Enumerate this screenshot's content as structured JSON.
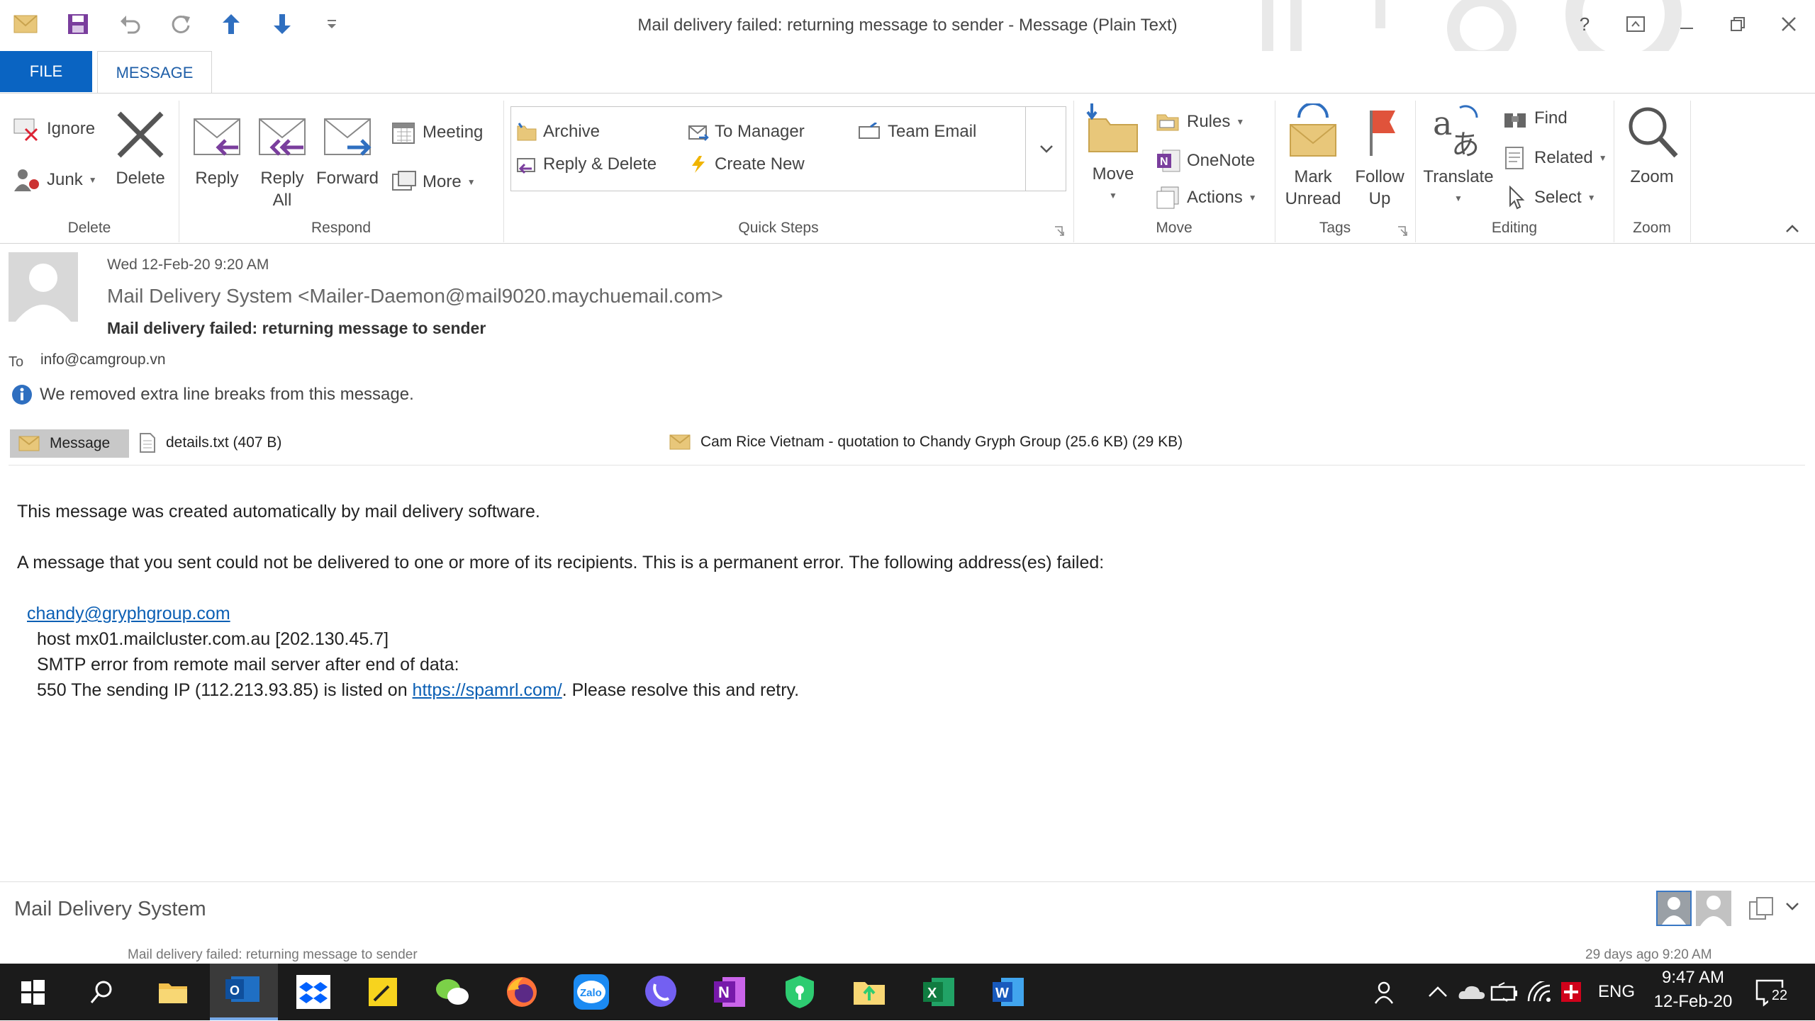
{
  "window": {
    "title": "Mail delivery failed: returning message to sender - Message (Plain Text)",
    "help": "?"
  },
  "tabs": {
    "file": "FILE",
    "message": "MESSAGE"
  },
  "ribbon": {
    "delete_group": {
      "label": "Delete",
      "ignore": "Ignore",
      "junk": "Junk",
      "delete": "Delete"
    },
    "respond_group": {
      "label": "Respond",
      "reply": "Reply",
      "reply_all_1": "Reply",
      "reply_all_2": "All",
      "forward": "Forward",
      "meeting": "Meeting",
      "more": "More"
    },
    "quick_steps": {
      "label": "Quick Steps",
      "items": [
        "Archive",
        "To Manager",
        "Team Email",
        "Reply & Delete",
        "Create New"
      ]
    },
    "move_group": {
      "label": "Move",
      "move": "Move",
      "rules": "Rules",
      "onenote": "OneNote",
      "actions": "Actions"
    },
    "tags_group": {
      "label": "Tags",
      "mark_unread_1": "Mark",
      "mark_unread_2": "Unread",
      "follow_up_1": "Follow",
      "follow_up_2": "Up"
    },
    "editing_group": {
      "label": "Editing",
      "translate": "Translate",
      "find": "Find",
      "related": "Related",
      "select": "Select"
    },
    "zoom_group": {
      "label": "Zoom",
      "zoom": "Zoom"
    }
  },
  "message": {
    "date": "Wed 12-Feb-20 9:20 AM",
    "from": "Mail Delivery System <Mailer-Daemon@mail9020.maychuemail.com>",
    "subject": "Mail delivery failed: returning message to sender",
    "to_label": "To",
    "to": "info@camgroup.vn",
    "info_bar": "We removed extra line breaks from this message.",
    "attachments": [
      "Message",
      "details.txt (407 B)",
      "Cam Rice Vietnam - quotation to Chandy Gryph Group (25.6 KB) (29 KB)"
    ],
    "body": {
      "line1": "This message was created automatically by mail delivery software.",
      "line2": "A message that you sent could not be delivered to one or more of its recipients. This is a permanent error. The following address(es) failed:",
      "recipient": "chandy@gryphgroup.com",
      "host": "host mx01.mailcluster.com.au [202.130.45.7]",
      "smtp": "SMTP error from remote mail server after end of data:",
      "error_prefix": "550 The sending IP (112.213.93.85) is listed on ",
      "error_link": "https://spamrl.com/",
      "error_suffix": ". Please resolve this and retry."
    }
  },
  "people_pane": {
    "name": "Mail Delivery System",
    "item_subject": "Mail delivery failed: returning message to sender",
    "item_time": "29 days ago 9:20 AM"
  },
  "taskbar": {
    "language": "ENG",
    "time": "9:47 AM",
    "date": "12-Feb-20",
    "notifications": "22"
  },
  "colors": {
    "accent": "#0a64c2",
    "link": "#0b5fb4",
    "taskbar": "#1b1b1b"
  }
}
